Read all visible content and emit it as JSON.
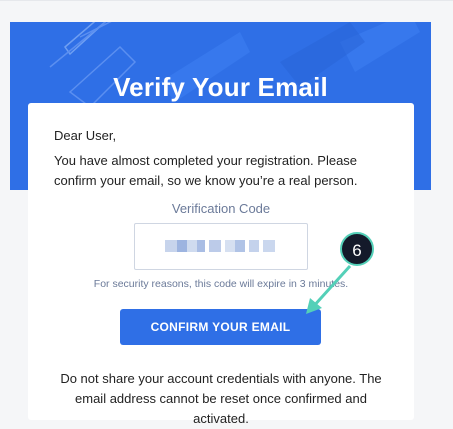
{
  "header": {
    "title": "Verify Your Email"
  },
  "card": {
    "greeting": "Dear User,",
    "intro": "You have almost completed your registration. Please confirm your email, so we know you’re a real person.",
    "code_label": "Verification Code",
    "expiry_note": "For security reasons, this code will expire in 3 minutes.",
    "confirm_label": "CONFIRM YOUR EMAIL",
    "footer_note": "Do not share your account credentials with anyone. The email address cannot be reset once confirmed and activated."
  },
  "annotation": {
    "step_number": "6"
  },
  "colors": {
    "brand": "#2f6fe6",
    "callout_bg": "#141a2a",
    "callout_accent": "#54d0b8"
  }
}
